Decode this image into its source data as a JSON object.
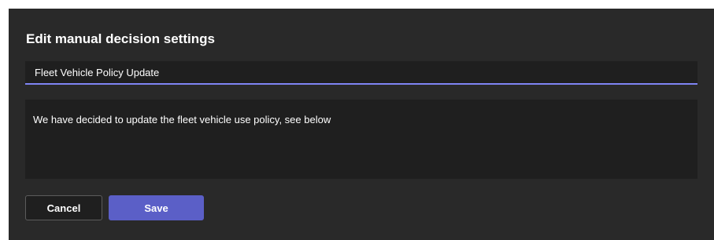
{
  "dialog": {
    "title": "Edit manual decision settings",
    "title_field": {
      "value": "Fleet Vehicle Policy Update",
      "placeholder": ""
    },
    "description_field": {
      "value": "We have decided to update the fleet vehicle use policy, see below",
      "placeholder": ""
    },
    "buttons": {
      "cancel_label": "Cancel",
      "save_label": "Save"
    }
  },
  "colors": {
    "dialog_background": "#292929",
    "field_background": "#1f1f1f",
    "focus_underline": "#7f85f5",
    "primary_button": "#5b5fc7",
    "text": "#ffffff"
  }
}
